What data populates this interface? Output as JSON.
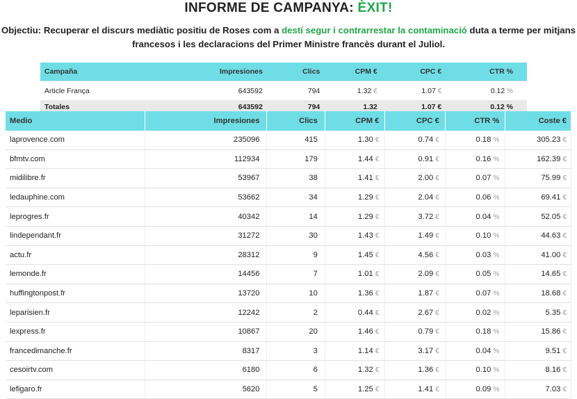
{
  "header": {
    "title_prefix": "INFORME DE CAMPANYA: ",
    "title_status": "ÈXIT!",
    "objective_part1": "Objectiu: Recuperar el discurs mediàtic positiu de Roses com a ",
    "objective_highlight": "destí segur i contrarrestar la contaminació",
    "objective_part2": " duta a terme per mitjans francesos i les declaracions del Primer Ministre francès durant el Juliol."
  },
  "campaign_table": {
    "columns": [
      "Campaña",
      "Impresiones",
      "Clics",
      "CPM €",
      "CPC €",
      "CTR %"
    ],
    "rows": [
      {
        "name": "Article França",
        "impressions": "643592",
        "clicks": "794",
        "cpm": "1.32",
        "cpc": "1.07",
        "ctr": "0.12"
      }
    ],
    "total": {
      "name": "Totales",
      "impressions": "643592",
      "clicks": "794",
      "cpm": "1.32",
      "cpc": "1.07",
      "ctr": "0.12 %"
    }
  },
  "media_table": {
    "columns": [
      "Medio",
      "Impresiones",
      "Clics",
      "CPM €",
      "CPC €",
      "CTR %",
      "Coste €"
    ],
    "rows": [
      {
        "medio": "laprovence.com",
        "impressions": "235096",
        "clicks": "415",
        "cpm": "1.30",
        "cpc": "0.74",
        "ctr": "0.18",
        "cost": "305.23"
      },
      {
        "medio": "bfmtv.com",
        "impressions": "112934",
        "clicks": "179",
        "cpm": "1.44",
        "cpc": "0.91",
        "ctr": "0.16",
        "cost": "162.39"
      },
      {
        "medio": "midilibre.fr",
        "impressions": "53967",
        "clicks": "38",
        "cpm": "1.41",
        "cpc": "2.00",
        "ctr": "0.07",
        "cost": "75.99"
      },
      {
        "medio": "ledauphine.com",
        "impressions": "53662",
        "clicks": "34",
        "cpm": "1.29",
        "cpc": "2.04",
        "ctr": "0.06",
        "cost": "69.41"
      },
      {
        "medio": "leprogres.fr",
        "impressions": "40342",
        "clicks": "14",
        "cpm": "1.29",
        "cpc": "3.72",
        "ctr": "0.04",
        "cost": "52.05"
      },
      {
        "medio": "lindependant.fr",
        "impressions": "31272",
        "clicks": "30",
        "cpm": "1.43",
        "cpc": "1.49",
        "ctr": "0.10",
        "cost": "44.63"
      },
      {
        "medio": "actu.fr",
        "impressions": "28312",
        "clicks": "9",
        "cpm": "1.45",
        "cpc": "4.56",
        "ctr": "0.03",
        "cost": "41.00"
      },
      {
        "medio": "lemonde.fr",
        "impressions": "14456",
        "clicks": "7",
        "cpm": "1.01",
        "cpc": "2.09",
        "ctr": "0.05",
        "cost": "14.65"
      },
      {
        "medio": "huffingtonpost.fr",
        "impressions": "13720",
        "clicks": "10",
        "cpm": "1.36",
        "cpc": "1.87",
        "ctr": "0.07",
        "cost": "18.68"
      },
      {
        "medio": "leparisien.fr",
        "impressions": "12242",
        "clicks": "2",
        "cpm": "0.44",
        "cpc": "2.67",
        "ctr": "0.02",
        "cost": "5.35"
      },
      {
        "medio": "lexpress.fr",
        "impressions": "10867",
        "clicks": "20",
        "cpm": "1.46",
        "cpc": "0.79",
        "ctr": "0.18",
        "cost": "15.86"
      },
      {
        "medio": "francedimanche.fr",
        "impressions": "8317",
        "clicks": "3",
        "cpm": "1.14",
        "cpc": "3.17",
        "ctr": "0.04",
        "cost": "9.51"
      },
      {
        "medio": "cesoirtv.com",
        "impressions": "6180",
        "clicks": "6",
        "cpm": "1.32",
        "cpc": "1.36",
        "ctr": "0.10",
        "cost": "8.16"
      },
      {
        "medio": "lefigaro.fr",
        "impressions": "5620",
        "clicks": "5",
        "cpm": "1.25",
        "cpc": "1.41",
        "ctr": "0.09",
        "cost": "7.03"
      }
    ]
  },
  "units": {
    "euro": "€",
    "percent": "%"
  },
  "colors": {
    "header_bg": "#6fdde6",
    "success_green": "#1fa64a"
  }
}
